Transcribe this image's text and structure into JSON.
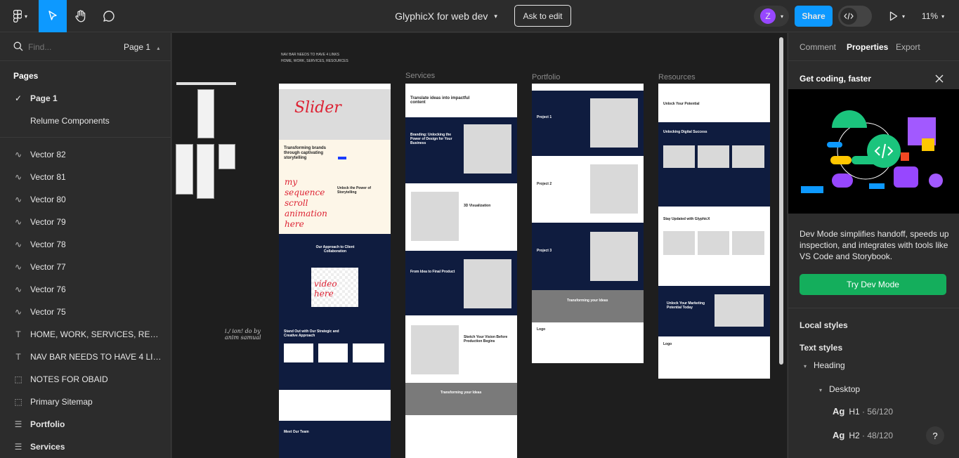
{
  "topbar": {
    "file_title": "GlyphicX for web dev",
    "ask_to_edit": "Ask to edit",
    "avatar_letter": "Z",
    "share": "Share",
    "zoom": "11%"
  },
  "left": {
    "search_placeholder": "Find...",
    "page_selector": "Page 1",
    "pages_heading": "Pages",
    "pages": [
      "Page 1",
      "Relume Components"
    ],
    "layers": [
      {
        "icon": "vector-icon",
        "label": "Vector 82"
      },
      {
        "icon": "vector-icon",
        "label": "Vector 81"
      },
      {
        "icon": "vector-icon",
        "label": "Vector 80"
      },
      {
        "icon": "vector-icon",
        "label": "Vector 79"
      },
      {
        "icon": "vector-icon",
        "label": "Vector 78"
      },
      {
        "icon": "vector-icon",
        "label": "Vector 77"
      },
      {
        "icon": "vector-icon",
        "label": "Vector 76"
      },
      {
        "icon": "vector-icon",
        "label": "Vector 75"
      },
      {
        "icon": "text-icon",
        "label": "HOME, WORK, SERVICES, RESOU..."
      },
      {
        "icon": "text-icon",
        "label": "NAV BAR NEEDS TO HAVE 4 LINKS"
      },
      {
        "icon": "section-icon",
        "label": "NOTES FOR OBAID"
      },
      {
        "icon": "section-icon",
        "label": "Primary Sitemap"
      },
      {
        "icon": "frame-icon",
        "label": "Portfolio"
      },
      {
        "icon": "frame-icon",
        "label": "Services"
      }
    ]
  },
  "canvas": {
    "note_line1": "NAV BAR NEEDS TO HAVE 4 LINKS",
    "note_line2": "HOME, WORK, SERVICES, RESOURCES",
    "frame_labels": {
      "services": "Services",
      "portfolio": "Portfolio",
      "resources": "Resources"
    },
    "home": {
      "hero_title": "Transforming brands through captivating storytelling",
      "story_title": "Unlock the Power of Storytelling",
      "approach_title": "Our Approach to Client Collaboration",
      "standout_title": "Stand Out with Our Strategic and Creative Approach",
      "team_title": "Meet Our Team",
      "handwriting_slider": "Slider",
      "handwriting_scroll": "my sequence scroll animation here",
      "handwriting_video": "video here"
    },
    "services": {
      "hero_title": "Translate ideas into impactful content",
      "branding_title": "Branding: Unlocking the Power of Design for Your Business",
      "viz_title": "3D Visualization",
      "idea_title": "From Idea to Final Product",
      "sketch_title": "Sketch Your Vision Before Production Begins",
      "cta_title": "Transforming your Ideas"
    },
    "portfolio": {
      "projects": [
        "Project 1",
        "Project 2",
        "Project 3"
      ],
      "cta_title": "Transforming your Ideas",
      "logo": "Logo"
    },
    "resources": {
      "hero_title": "Unlock Your Potential",
      "success_title": "Unlocking Digital Success",
      "updated_title": "Stay Updated with GlyphicX",
      "marketing_title": "Unlock Your Marketing Potential Today",
      "logo": "Logo"
    }
  },
  "right": {
    "tabs": [
      "Comment",
      "Properties",
      "Export"
    ],
    "banner_title": "Get coding, faster",
    "banner_text": "Dev Mode simplifies handoff, speeds up inspection, and integrates with tools like VS Code and Storybook.",
    "try_button": "Try Dev Mode",
    "local_styles": "Local styles",
    "text_styles": "Text styles",
    "heading_group": "Heading",
    "desktop_group": "Desktop",
    "styles": [
      {
        "sample": "Ag",
        "name": "H1",
        "spec": "· 56/120"
      },
      {
        "sample": "Ag",
        "name": "H2",
        "spec": "· 48/120"
      }
    ],
    "help": "?"
  },
  "colors": {
    "accent": "#0d99ff",
    "navy": "#0f1c3f",
    "try_button": "#14ae5c",
    "avatar": "#9747ff"
  }
}
